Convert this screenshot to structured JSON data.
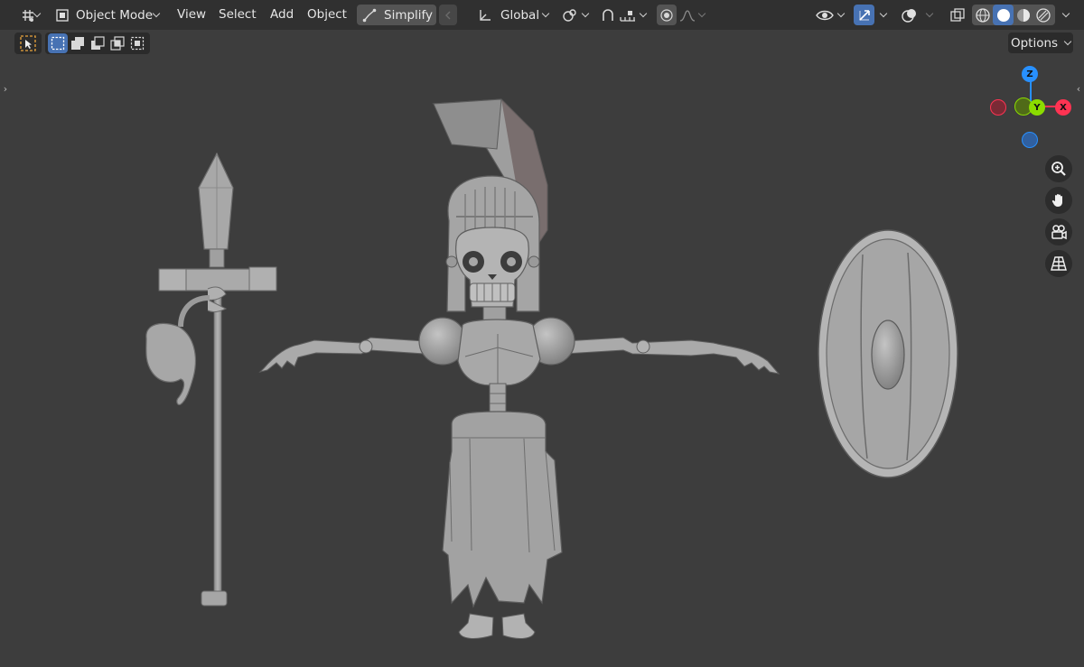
{
  "header": {
    "mode_label": "Object Mode",
    "menus": [
      "View",
      "Select",
      "Add",
      "Object"
    ],
    "simplify_label": "Simplify",
    "transform_orientation": "Global"
  },
  "toolbar": {
    "options_label": "Options"
  },
  "gizmo": {
    "z_label": "Z",
    "y_label": "Y",
    "x_label": "X"
  },
  "colors": {
    "header_bg": "#303030",
    "viewport_bg": "#3d3d3d",
    "accent": "#4772b3",
    "axis_x": "#ff3352",
    "axis_y": "#8bdc00",
    "axis_z": "#2890ff",
    "model": "#a9a9a9"
  },
  "icons": [
    "editor-type-icon",
    "object-mode-icon",
    "simplify-curve-icon",
    "transform-orientation-icon",
    "pivot-icon",
    "snap-icon",
    "proportional-edit-icon",
    "visibility-icon",
    "gizmo-icon",
    "overlay-icon",
    "xray-icon",
    "wireframe-shading-icon",
    "solid-shading-icon",
    "material-shading-icon",
    "rendered-shading-icon",
    "zoom-icon",
    "hand-pan-icon",
    "camera-icon",
    "grid-perspective-icon"
  ]
}
